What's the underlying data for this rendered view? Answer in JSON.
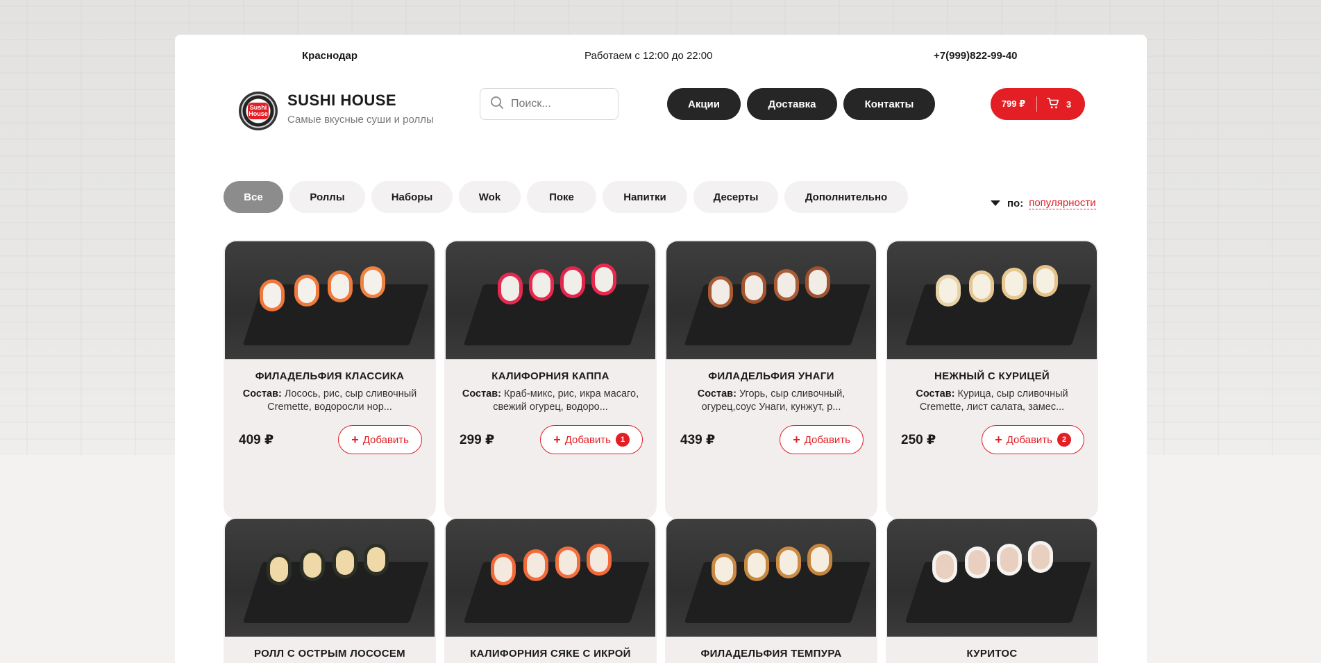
{
  "header": {
    "city": "Краснодар",
    "hours": "Работаем с 12:00 до 22:00",
    "phone": "+7(999)822-99-40",
    "brand_name": "SUSHI HOUSE",
    "brand_tagline": "Самые вкусные суши и роллы",
    "logo_text": "Sushi House",
    "search_placeholder": "Поиск...",
    "nav": [
      "Акции",
      "Доставка",
      "Контакты"
    ],
    "cart_sum": "799 ₽",
    "cart_count": "3"
  },
  "categories": [
    "Все",
    "Роллы",
    "Наборы",
    "Wok",
    "Поке",
    "Напитки",
    "Десерты",
    "Дополнительно"
  ],
  "active_category": "Все",
  "sort": {
    "label": "по:",
    "value": "популярности"
  },
  "products": [
    {
      "title": "Филадельфия классика",
      "desc_label": "Состав:",
      "desc": "Лосось, рис, сыр сливочный Cremette, водоросли нор...",
      "price": "409 ₽",
      "add_label": "Добавить",
      "qty": ""
    },
    {
      "title": "Калифорния каппа",
      "desc_label": "Состав:",
      "desc": "Краб-микс, рис, икра масаго, свежий огурец, водоро...",
      "price": "299 ₽",
      "add_label": "Добавить",
      "qty": "1"
    },
    {
      "title": "Филадельфия унаги",
      "desc_label": "Состав:",
      "desc": "Угорь, сыр сливочный, огурец,соус Унаги, кунжут, р...",
      "price": "439 ₽",
      "add_label": "Добавить",
      "qty": ""
    },
    {
      "title": "Нежный с курицей",
      "desc_label": "Состав:",
      "desc": "Курица, сыр сливочный Cremette, лист салата, замес...",
      "price": "250 ₽",
      "add_label": "Добавить",
      "qty": "2"
    },
    {
      "title": "Ролл с острым лососем"
    },
    {
      "title": "Калифорния сяке с икрой"
    },
    {
      "title": "Филадельфия темпура"
    },
    {
      "title": "Куритос"
    }
  ],
  "colors": {
    "accent": "#e31e24",
    "dark_button": "#262626",
    "card_bg": "#f3eeee"
  }
}
